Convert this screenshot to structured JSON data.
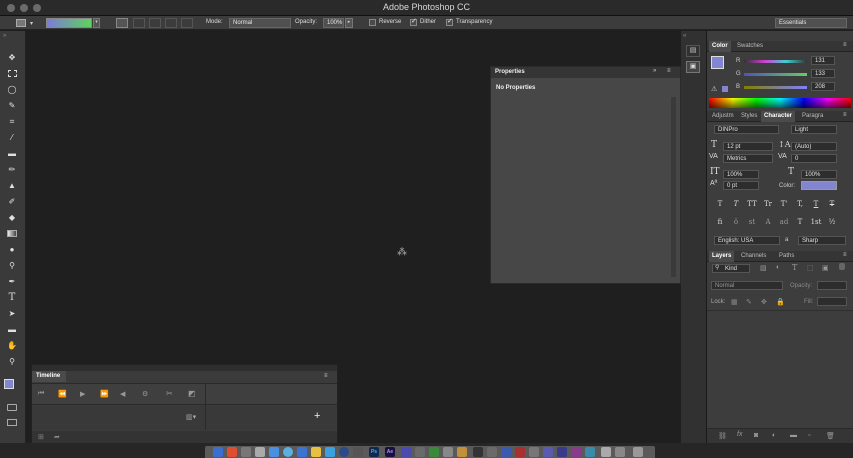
{
  "window": {
    "title": "Adobe Photoshop CC"
  },
  "options_bar": {
    "mode_label": "Mode:",
    "mode_value": "Normal",
    "opacity_label": "Opacity:",
    "opacity_value": "100%",
    "reverse_label": "Reverse",
    "dither_label": "Dither",
    "transparency_label": "Transparency",
    "workspace_value": "Essentials",
    "reverse_checked": false,
    "dither_checked": true,
    "transparency_checked": true
  },
  "tools": [
    "move-tool",
    "marquee-tool",
    "lasso-tool",
    "quick-selection-tool",
    "crop-tool",
    "eyedropper-tool",
    "healing-brush-tool",
    "brush-tool",
    "clone-stamp-tool",
    "history-brush-tool",
    "eraser-tool",
    "gradient-tool",
    "blur-tool",
    "dodge-tool",
    "pen-tool",
    "type-tool",
    "path-selection-tool",
    "rectangle-tool",
    "hand-tool",
    "zoom-tool"
  ],
  "properties_panel": {
    "title": "Properties",
    "body": "No Properties"
  },
  "timeline_panel": {
    "title": "Timeline"
  },
  "color_panel": {
    "tabs": [
      "Color",
      "Swatches"
    ],
    "r_label": "R",
    "r_value": "131",
    "g_label": "G",
    "g_value": "133",
    "b_label": "B",
    "b_value": "208",
    "foreground_color": "#8385d0"
  },
  "character_panel": {
    "tabs": [
      "Adjustm",
      "Styles",
      "Character",
      "Paragra"
    ],
    "font_family": "DINPro",
    "font_style": "Light",
    "font_size": "12 pt",
    "leading": "(Auto)",
    "kerning": "Metrics",
    "tracking": "0",
    "vertical_scale": "100%",
    "horizontal_scale": "100%",
    "baseline_shift": "0 pt",
    "color_label": "Color:",
    "language": "English: USA",
    "anti_alias_label": "a",
    "anti_alias": "Sharp",
    "type_buttons_1": [
      "T",
      "T",
      "TT",
      "Tr",
      "T'",
      "T,",
      "T",
      "T"
    ],
    "type_buttons_2": [
      "fi",
      "ô",
      "st",
      "A",
      "ad",
      "T",
      "1st",
      "½"
    ]
  },
  "layers_panel": {
    "tabs": [
      "Layers",
      "Channels",
      "Paths"
    ],
    "filter_label": "Kind",
    "blend_mode": "Normal",
    "opacity_label": "Opacity:",
    "lock_label": "Lock:",
    "fill_label": "Fill:"
  },
  "dock_apps": [
    "Ps",
    "Ae"
  ]
}
